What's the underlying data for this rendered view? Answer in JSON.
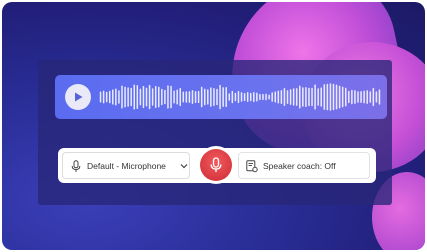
{
  "player": {
    "play_icon": "play-icon",
    "play_label": "Play recording"
  },
  "controls": {
    "microphone_label": "Default - Microphone",
    "microphone_icon": "microphone-icon",
    "dropdown_icon": "chevron-down-icon",
    "record_icon": "microphone-icon",
    "speaker_coach_label": "Speaker coach: Off",
    "speaker_coach_icon": "speaker-coach-icon"
  },
  "colors": {
    "record": "#d83940",
    "waveform_bar": "#6a72ee",
    "background": "#2a2f9a",
    "accent_blob": "#c24fd8"
  }
}
